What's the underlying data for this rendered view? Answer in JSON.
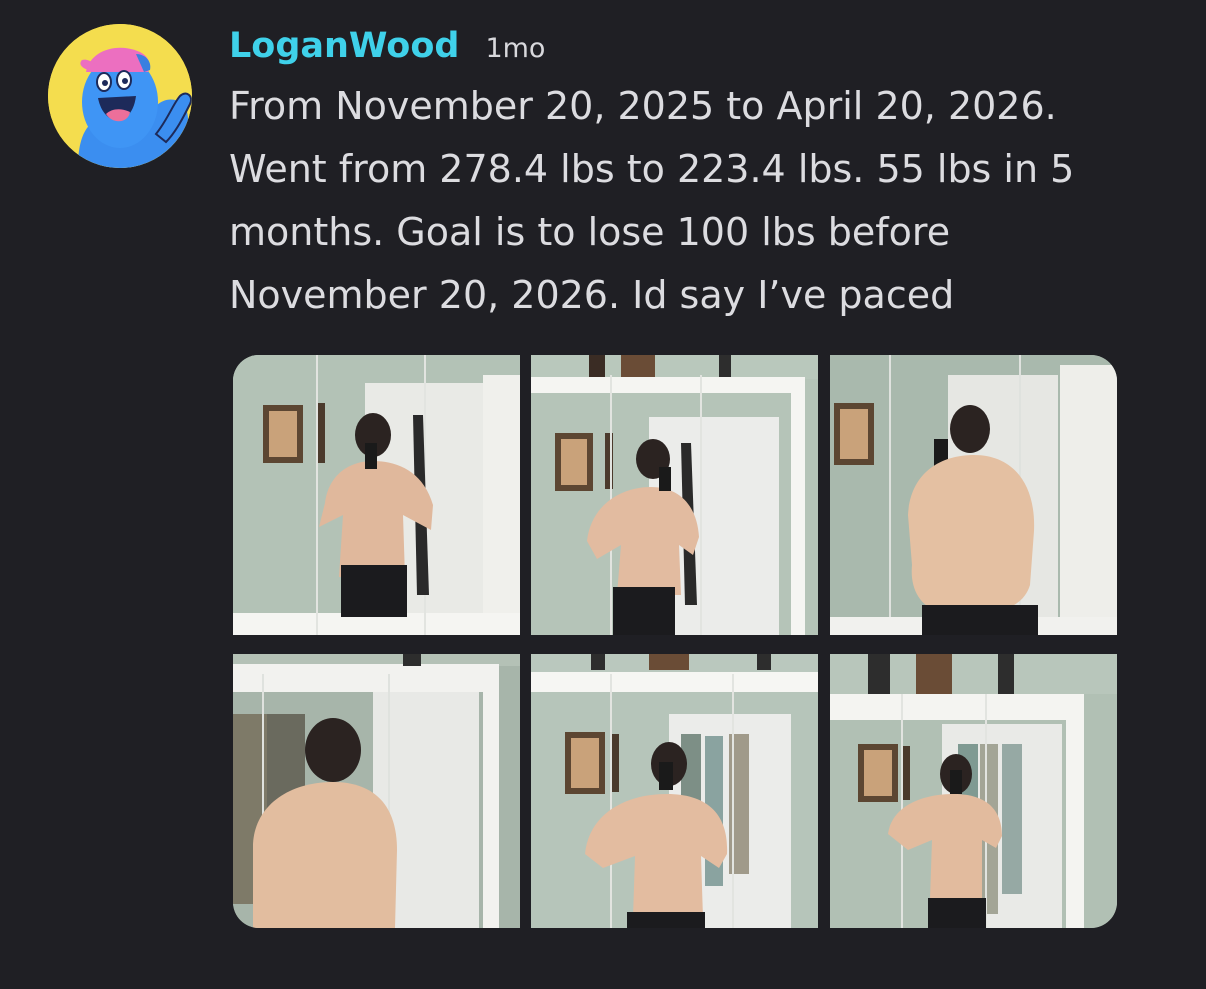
{
  "post": {
    "author": "LoganWood",
    "timestamp": "1mo",
    "message": "From November 20, 2025 to April 20, 2026.\nWent from 278.4 lbs to 223.4 lbs. 55 lbs in 5\nmonths. Goal is to lose 100 lbs before\nNovember 20, 2026. Id say I’ve paced",
    "avatar_icon": "blue-character-avatar-icon",
    "colors": {
      "background": "#1f1f24",
      "username": "#3fd1ea",
      "text": "#dcdce0",
      "avatar_bg": "#f4dd4e"
    }
  },
  "gallery": {
    "photo_count": 6,
    "photos": [
      {
        "view": "front"
      },
      {
        "view": "front"
      },
      {
        "view": "back"
      },
      {
        "view": "back"
      },
      {
        "view": "front"
      },
      {
        "view": "front"
      }
    ]
  }
}
